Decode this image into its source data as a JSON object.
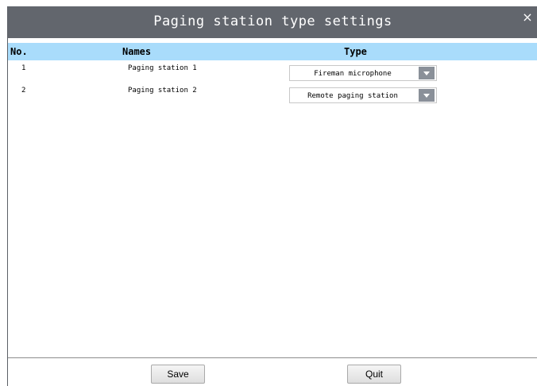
{
  "dialog": {
    "title": "Paging station type settings",
    "close_label": "×"
  },
  "table": {
    "columns": [
      "No.",
      "Names",
      "Type"
    ],
    "rows": [
      {
        "no": "1",
        "name": "Paging station 1",
        "type": "Fireman microphone"
      },
      {
        "no": "2",
        "name": "Paging station 2",
        "type": "Remote paging station"
      }
    ]
  },
  "footer": {
    "save_label": "Save",
    "quit_label": "Quit"
  },
  "colors": {
    "titlebar": "#62666d",
    "header": "#a9dcfb",
    "dropdown_arrow": "#8a9099"
  },
  "icons": {
    "close": "close-icon",
    "dropdown": "chevron-down-icon"
  }
}
